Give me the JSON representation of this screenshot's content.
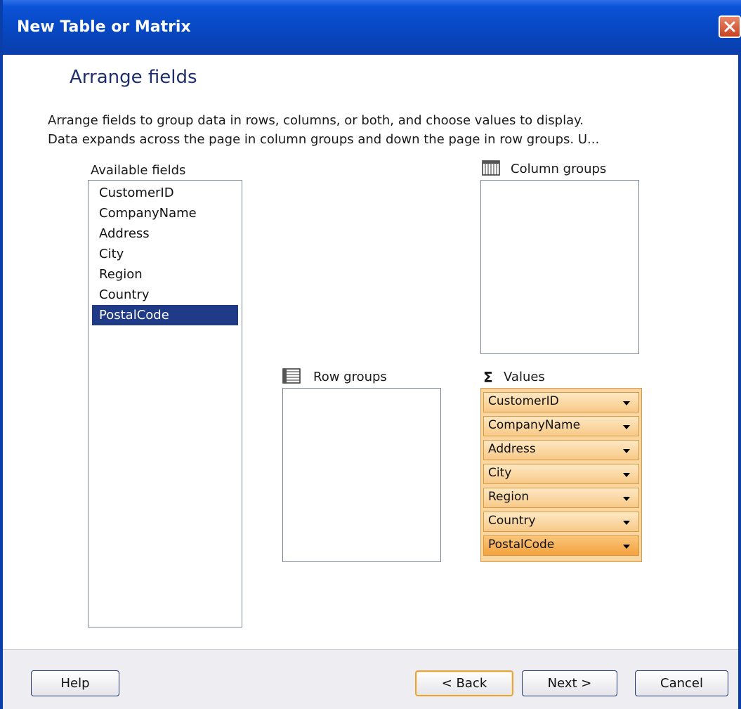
{
  "window": {
    "title": "New Table or Matrix"
  },
  "page": {
    "heading": "Arrange fields",
    "description_lines": [
      "Arrange fields to group data in rows, columns, or both, and choose values to display.",
      "Data expands across the page in column groups and down the page in row groups.  U..."
    ]
  },
  "available_fields": {
    "label": "Available fields",
    "items": [
      "CustomerID",
      "CompanyName",
      "Address",
      "City",
      "Region",
      "Country",
      "PostalCode"
    ],
    "selected": "PostalCode"
  },
  "column_groups": {
    "label": "Column groups",
    "icon": "column-groups-icon",
    "items": []
  },
  "row_groups": {
    "label": "Row groups",
    "icon": "row-groups-icon",
    "items": []
  },
  "values": {
    "label": "Values",
    "icon_glyph": "Σ",
    "items": [
      "CustomerID",
      "CompanyName",
      "Address",
      "City",
      "Region",
      "Country",
      "PostalCode"
    ],
    "active": "PostalCode"
  },
  "buttons": {
    "help": "Help",
    "back": "< Back",
    "next": "Next >",
    "cancel": "Cancel"
  },
  "colors": {
    "title_bar": "#0747c2",
    "selection": "#1f3a86",
    "value_item": "#f8c987",
    "value_active": "#f3a23e",
    "heading": "#1f2f6e"
  }
}
